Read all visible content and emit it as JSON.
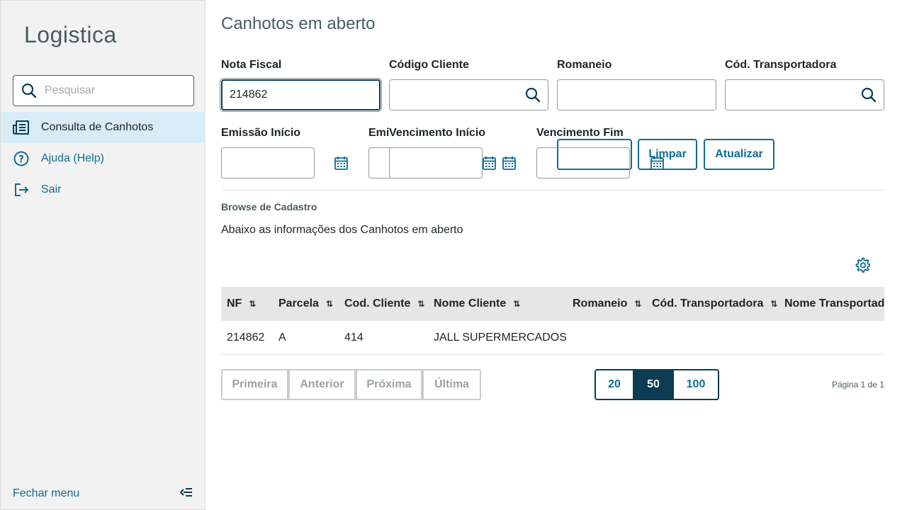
{
  "sidebar": {
    "app_title": "Logistica",
    "search_placeholder": "Pesquisar",
    "items": [
      {
        "label": "Consulta de Canhotos",
        "icon": "receipt-list-icon"
      },
      {
        "label": "Ajuda (Help)",
        "icon": "help-circle-icon"
      },
      {
        "label": "Sair",
        "icon": "logout-icon"
      }
    ],
    "collapse_label": "Fechar menu"
  },
  "page": {
    "title": "Canhotos em aberto"
  },
  "filters": {
    "nota_fiscal": {
      "label": "Nota Fiscal",
      "value": "214862"
    },
    "codigo_cliente": {
      "label": "Código Cliente",
      "value": ""
    },
    "romaneio": {
      "label": "Romaneio",
      "value": ""
    },
    "cod_transportadora": {
      "label": "Cód. Transportadora",
      "value": ""
    },
    "emissao_inicio": {
      "label": "Emissão Início",
      "value": ""
    },
    "emissao_fim": {
      "label": "Emissão Fim",
      "value": ""
    },
    "vencimento_inicio": {
      "label": "Vencimento Início",
      "value": ""
    },
    "vencimento_fim": {
      "label": "Vencimento Fim",
      "value": ""
    }
  },
  "actions": {
    "limpar": "Limpar",
    "atualizar": "Atualizar"
  },
  "browse": {
    "title": "Browse de Cadastro",
    "description": "Abaixo as informações dos Canhotos em aberto"
  },
  "table": {
    "columns": [
      "NF",
      "Parcela",
      "Cod. Cliente",
      "Nome Cliente",
      "Romaneio",
      "Cód. Transportadora",
      "Nome Transportadora"
    ],
    "rows": [
      [
        "214862",
        "A",
        "414",
        "JALL SUPERMERCADOS",
        "",
        "",
        ""
      ]
    ]
  },
  "pagination": {
    "first": "Primeira",
    "previous": "Anterior",
    "next": "Próxima",
    "last": "Última",
    "page_sizes": [
      "20",
      "50",
      "100"
    ],
    "selected_page_size": "50",
    "page_info": "Página 1 de 1"
  },
  "colors": {
    "accent": "#0c6c94",
    "dark": "#0c3b54",
    "active_menu_bg": "#d8ecf7"
  }
}
